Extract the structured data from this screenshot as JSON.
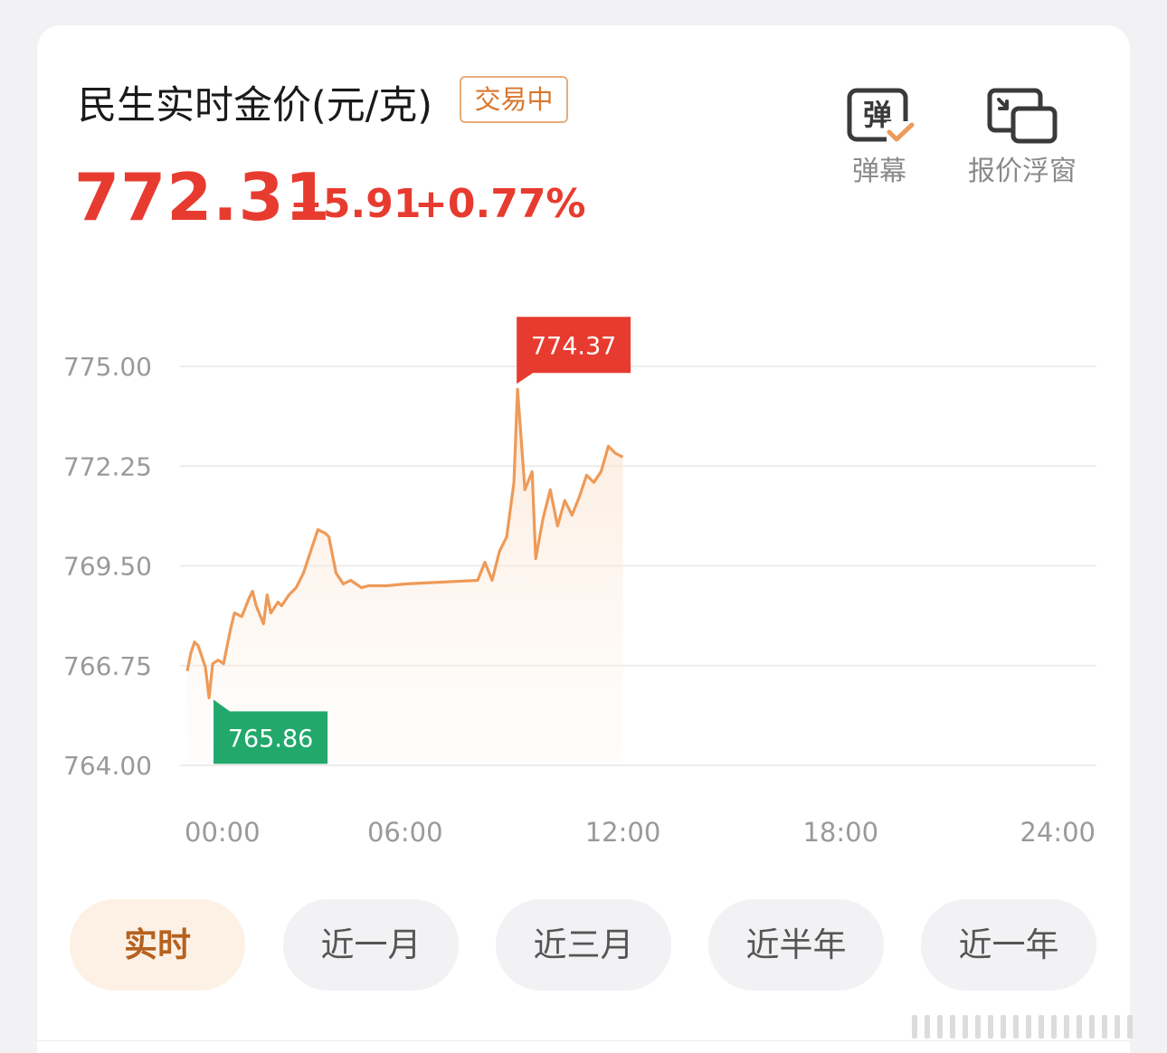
{
  "header": {
    "title": "民生实时金价(元/克)",
    "status_badge": "交易中",
    "price": "772.31",
    "change": "+5.91",
    "change_pct": "+0.77%"
  },
  "tools": [
    {
      "label": "弹幕",
      "icon_text": "弹",
      "icon": "danmu-check-icon"
    },
    {
      "label": "报价浮窗",
      "icon": "floating-window-icon"
    }
  ],
  "periods": [
    {
      "label": "实时",
      "active": true
    },
    {
      "label": "近一月",
      "active": false
    },
    {
      "label": "近三月",
      "active": false
    },
    {
      "label": "近半年",
      "active": false
    },
    {
      "label": "近一年",
      "active": false
    }
  ],
  "colors": {
    "up": "#e83b30",
    "down": "#22a86b",
    "line": "#ee9a58",
    "accent": "#d9772f"
  },
  "chart_data": {
    "type": "area",
    "title": "",
    "xlabel": "",
    "ylabel": "",
    "ylim": [
      764.0,
      775.0
    ],
    "xlim": [
      0,
      24
    ],
    "yticks": [
      "775.00",
      "772.25",
      "769.50",
      "766.75",
      "764.00"
    ],
    "xticks": [
      "00:00",
      "06:00",
      "12:00",
      "18:00",
      "24:00"
    ],
    "grid": true,
    "high_label": "774.37",
    "low_label": "765.86",
    "high": {
      "x": 9.0,
      "y": 774.37
    },
    "low": {
      "x": 0.6,
      "y": 765.86
    },
    "series": [
      {
        "x": [
          0.0,
          0.1,
          0.2,
          0.3,
          0.4,
          0.5,
          0.6,
          0.7,
          0.85,
          1.0,
          1.2,
          1.3,
          1.5,
          1.7,
          1.8,
          1.9,
          2.1,
          2.2,
          2.3,
          2.5,
          2.6,
          2.8,
          3.0,
          3.2,
          3.3,
          3.5,
          3.6,
          3.8,
          3.9,
          4.1,
          4.3,
          4.5,
          4.8,
          5.0,
          5.5,
          6.0,
          7.0,
          8.0,
          8.2,
          8.4,
          8.6,
          8.8,
          9.0,
          9.1,
          9.3,
          9.5,
          9.6,
          9.8,
          10.0,
          10.2,
          10.4,
          10.6,
          10.8,
          11.0,
          11.2,
          11.4,
          11.6,
          11.8,
          12.0
        ],
        "y": [
          766.6,
          767.1,
          767.4,
          767.3,
          767.0,
          766.7,
          765.86,
          766.8,
          766.9,
          766.8,
          767.8,
          768.2,
          768.1,
          768.6,
          768.8,
          768.4,
          767.9,
          768.7,
          768.2,
          768.5,
          768.4,
          768.7,
          768.9,
          769.3,
          769.6,
          770.2,
          770.5,
          770.4,
          770.3,
          769.3,
          769.0,
          769.1,
          768.9,
          768.95,
          768.95,
          769.0,
          769.05,
          769.1,
          769.6,
          769.1,
          769.9,
          770.3,
          771.8,
          774.37,
          771.6,
          772.1,
          769.7,
          770.8,
          771.6,
          770.6,
          771.3,
          770.9,
          771.4,
          772.0,
          771.8,
          772.1,
          772.8,
          772.6,
          772.5
        ]
      }
    ]
  }
}
